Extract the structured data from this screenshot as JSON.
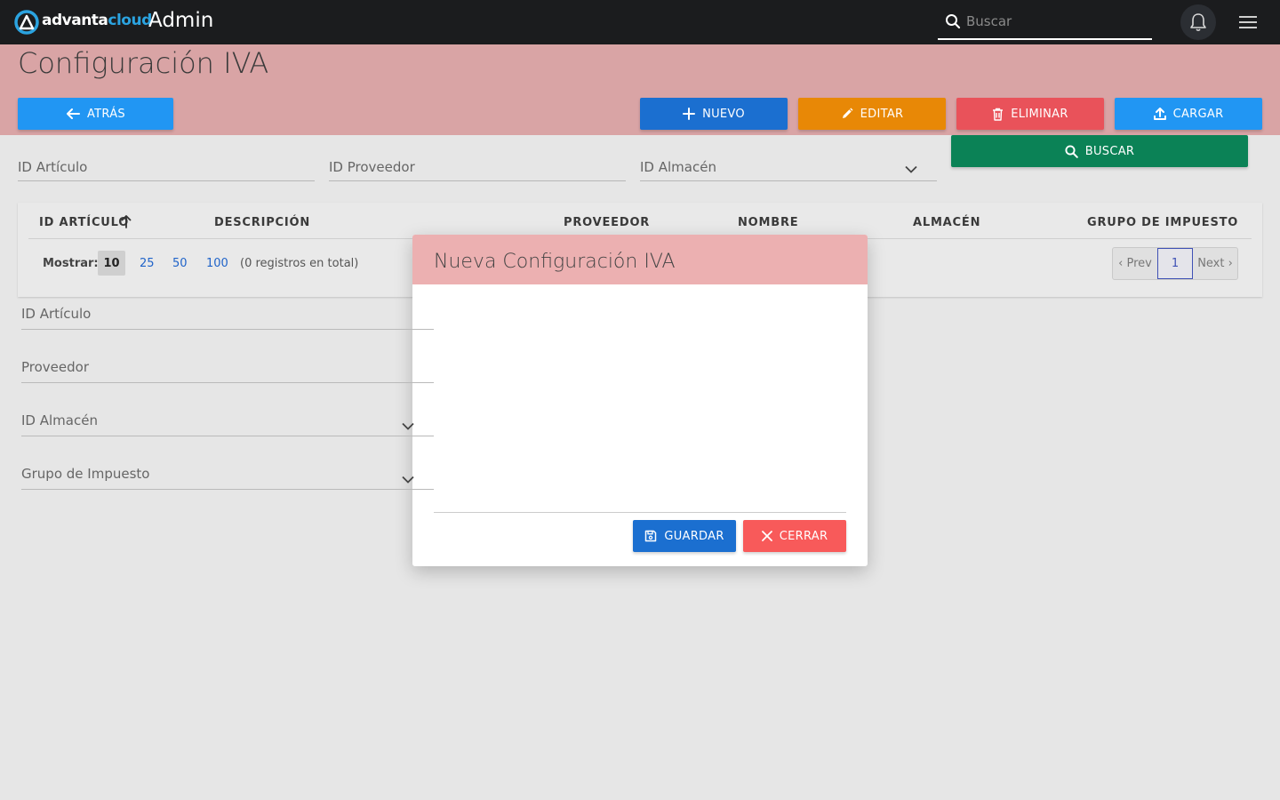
{
  "topbar": {
    "brand_main": "advanta",
    "brand_accent": "cloud",
    "app_title": "Admin",
    "search_placeholder": "Buscar"
  },
  "page": {
    "title": "Configuración IVA"
  },
  "toolbar": {
    "back": "ATRÁS",
    "new": "NUEVO",
    "edit": "EDITAR",
    "delete": "ELIMINAR",
    "load": "CARGAR",
    "search": "BUSCAR"
  },
  "filters": {
    "id_articulo": "ID Artículo",
    "id_proveedor": "ID Proveedor",
    "id_almacen": "ID Almacén"
  },
  "table": {
    "columns": [
      "ID ARTÍCULO",
      "DESCRIPCIÓN",
      "PROVEEDOR",
      "NOMBRE",
      "ALMACÉN",
      "GRUPO DE IMPUESTO"
    ],
    "sort_column": "ID ARTÍCULO",
    "sort_direction": "ascending"
  },
  "pagination": {
    "show_label": "Mostrar:",
    "page_sizes": [
      "10",
      "25",
      "50",
      "100"
    ],
    "selected_size": "10",
    "total_text": "(0 registros en total)",
    "prev": "‹ Prev",
    "current_page": "1",
    "next": "Next ›"
  },
  "modal": {
    "title": "Nueva Configuración IVA",
    "fields": {
      "id_articulo": "ID Artículo",
      "proveedor": "Proveedor",
      "id_almacen": "ID Almacén",
      "grupo_impuesto": "Grupo de Impuesto"
    },
    "save": "GUARDAR",
    "close": "CERRAR"
  },
  "colors": {
    "topbar": "#1b1c1e",
    "header_band": "#d9a4a5",
    "modal_header": "#ecb0b1",
    "brand_accent": "#2ba3e0",
    "back_button": "#2196f3",
    "new_button": "#1b6fd0",
    "edit_button": "#e88806",
    "delete_button": "#e9525a",
    "load_button": "#2196f3",
    "search_button": "#0b8256",
    "close_button": "#f85a5a"
  },
  "icons": {
    "logo": "advantacloud-logo-icon",
    "search": "search-icon",
    "bell": "bell-icon",
    "menu": "hamburger-menu-icon",
    "back": "arrow-left-icon",
    "new": "plus-icon",
    "edit": "pencil-icon",
    "delete": "trash-icon",
    "load": "upload-icon",
    "sort": "arrow-up-icon",
    "dropdown": "chevron-down-icon",
    "save": "floppy-disk-icon",
    "close": "close-icon"
  }
}
